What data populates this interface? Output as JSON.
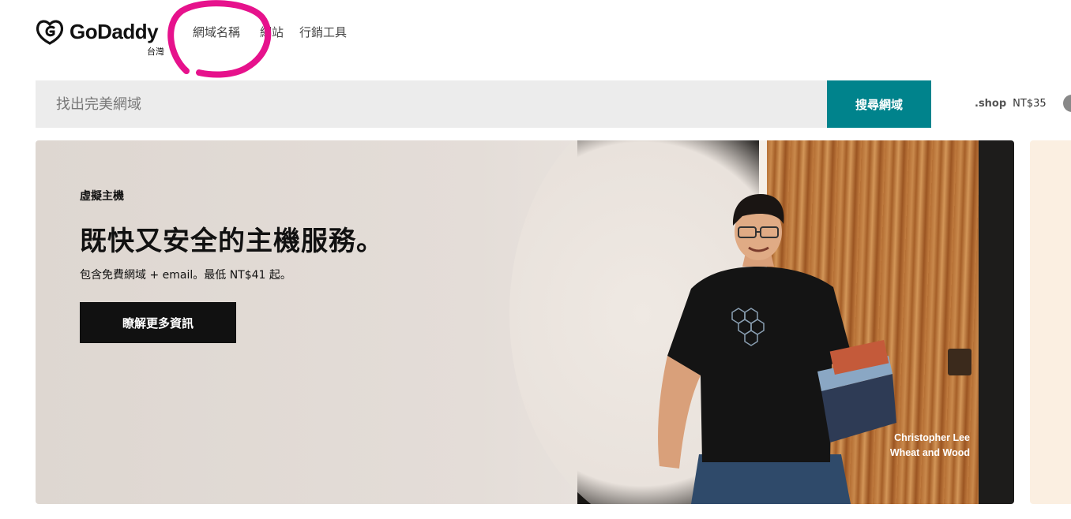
{
  "brand": {
    "name": "GoDaddy",
    "locale": "台灣"
  },
  "nav": {
    "items": [
      {
        "label": "網域名稱"
      },
      {
        "label": "網站"
      },
      {
        "label": "行銷工具"
      }
    ]
  },
  "search": {
    "placeholder": "找出完美網域",
    "button_label": "搜尋網域"
  },
  "promo": {
    "tld": ".shop",
    "price": "NT$35"
  },
  "hero": {
    "eyebrow": "虛擬主機",
    "headline": "既快又安全的主機服務。",
    "subtext": "包含免費網域 + email。最低 NT$41 起。",
    "cta_label": "瞭解更多資訊",
    "credit_name": "Christopher Lee",
    "credit_company": "Wheat and Wood"
  },
  "colors": {
    "accent": "#00838c",
    "cta": "#111111",
    "annotation": "#e6128c"
  }
}
